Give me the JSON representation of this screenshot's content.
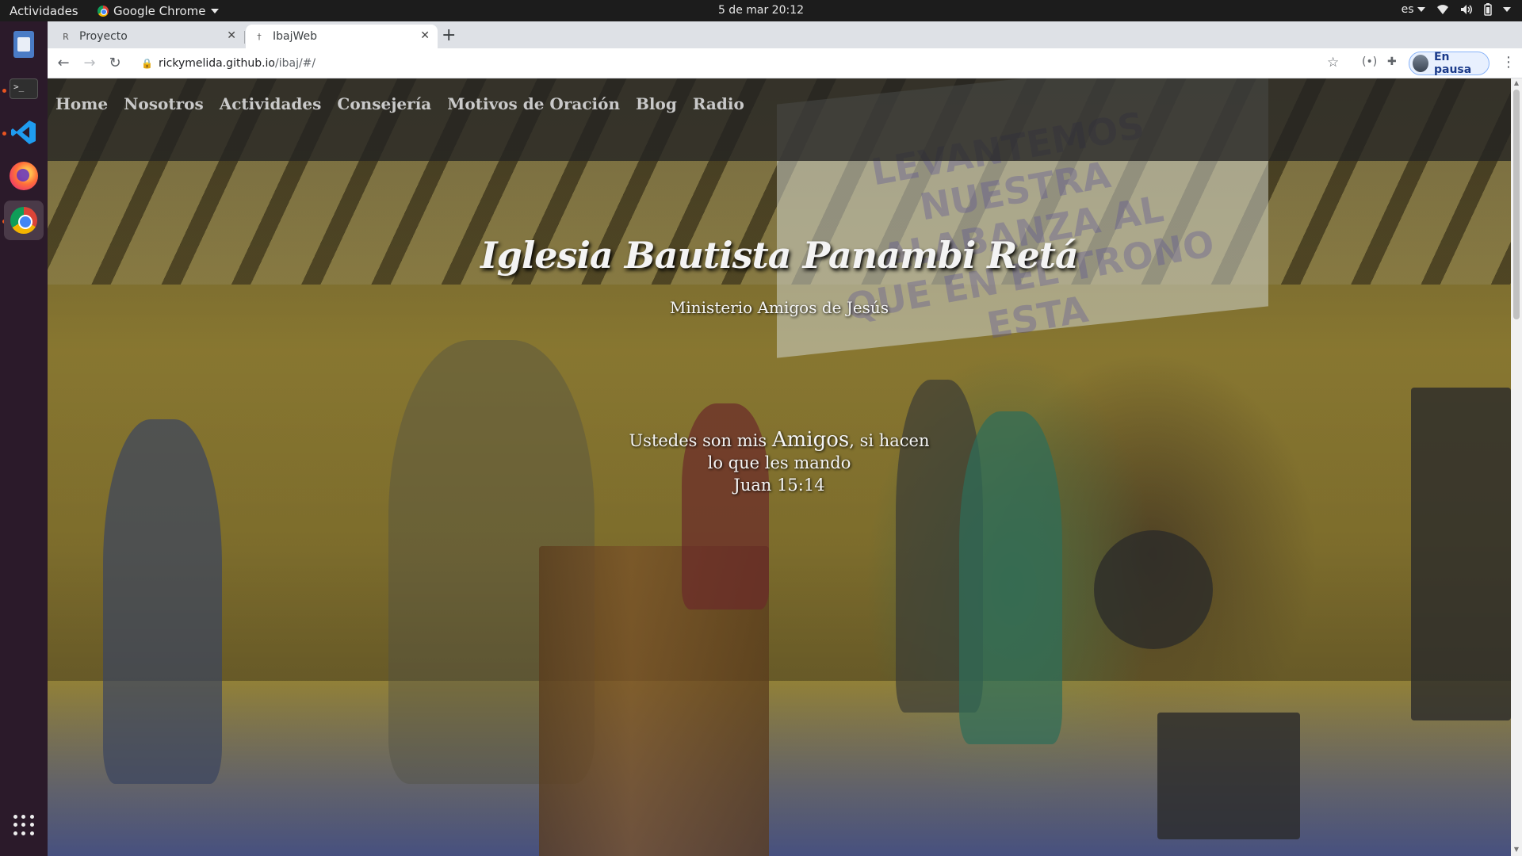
{
  "topbar": {
    "activities": "Actividades",
    "app_name": "Google Chrome",
    "clock": "5 de mar  20:12",
    "keyboard_layout": "es"
  },
  "dock": {
    "items": [
      {
        "name": "Files",
        "icon": "files-icon"
      },
      {
        "name": "Terminal",
        "icon": "terminal-icon"
      },
      {
        "name": "Visual Studio Code",
        "icon": "vscode-icon"
      },
      {
        "name": "Firefox",
        "icon": "firefox-icon"
      },
      {
        "name": "Google Chrome",
        "icon": "chrome-icon"
      }
    ],
    "apps_grid_icon": "show-applications-icon"
  },
  "browser": {
    "tabs": [
      {
        "title": "Proyecto",
        "favicon": "R",
        "active": false
      },
      {
        "title": "IbajWeb",
        "favicon": "†",
        "active": true
      }
    ],
    "url_host": "rickymelida.github.io",
    "url_path": "/ibaj/#/",
    "profile_label": "En pausa"
  },
  "site": {
    "nav": [
      "Home",
      "Nosotros",
      "Actividades",
      "Consejería",
      "Motivos de Oración",
      "Blog",
      "Radio"
    ],
    "title": "Iglesia Bautista Panambi Retá",
    "subtitle": "Ministerio Amigos de Jesús",
    "verse": {
      "pre": "Ustedes son mis ",
      "highlight": "Amigos",
      "post": ", si hacen",
      "line2": "lo que les mando",
      "reference": "Juan 15:14"
    },
    "background_screen_text": "LEVANTEMOS NUESTRA ALABANZA AL QUE EN EL TRONO ESTA"
  },
  "colors": {
    "gnome_topbar": "#1c1c1c",
    "dock": "#2b1a2a",
    "tabstrip": "#dee1e6",
    "nav_overlay": "#232323",
    "hero_text": "#f5f5f5"
  }
}
